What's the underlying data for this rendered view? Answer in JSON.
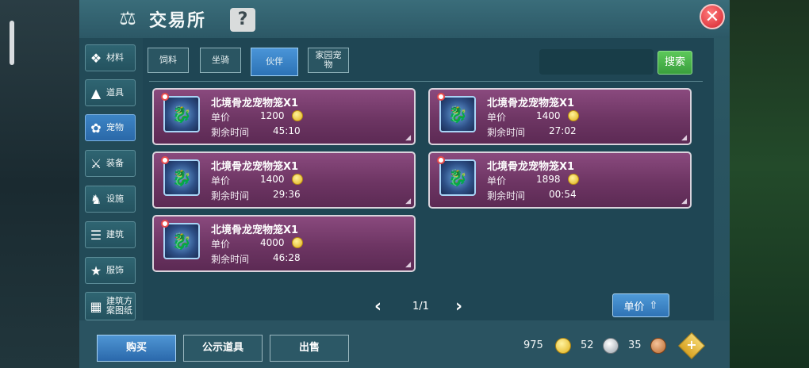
{
  "window": {
    "title": "交易所",
    "help_label": "?",
    "close_label": "✕"
  },
  "sidebar": {
    "items": [
      {
        "label": "材料",
        "icon": "materials-icon"
      },
      {
        "label": "道具",
        "icon": "item-flask-icon"
      },
      {
        "label": "宠物",
        "icon": "paw-icon",
        "active": true
      },
      {
        "label": "装备",
        "icon": "equipment-icon"
      },
      {
        "label": "设施",
        "icon": "facility-icon"
      },
      {
        "label": "建筑",
        "icon": "building-icon"
      },
      {
        "label": "服饰",
        "icon": "clothing-icon"
      },
      {
        "label": "建筑方案图纸",
        "icon": "blueprint-icon"
      }
    ]
  },
  "tabs": [
    {
      "label": "饲料"
    },
    {
      "label": "坐骑"
    },
    {
      "label": "伙伴",
      "active": true
    },
    {
      "label": "家园宠物"
    }
  ],
  "search": {
    "placeholder": "",
    "button_label": "搜索"
  },
  "listing_labels": {
    "price": "单价",
    "time": "剩余时间"
  },
  "listings": [
    {
      "name": "北境骨龙宠物笼X1",
      "price": "1200",
      "time": "45:10"
    },
    {
      "name": "北境骨龙宠物笼X1",
      "price": "1400",
      "time": "27:02"
    },
    {
      "name": "北境骨龙宠物笼X1",
      "price": "1400",
      "time": "29:36"
    },
    {
      "name": "北境骨龙宠物笼X1",
      "price": "1898",
      "time": "00:54"
    },
    {
      "name": "北境骨龙宠物笼X1",
      "price": "4000",
      "time": "46:28"
    }
  ],
  "pager": {
    "text": "1/1"
  },
  "sort": {
    "label": "单价"
  },
  "bottom": {
    "buy_label": "购买",
    "public_label": "公示道具",
    "sell_label": "出售",
    "gold": "975",
    "silver": "52",
    "bronze": "35"
  },
  "colors": {
    "accent": "#2f73b5",
    "card": "#6d3563",
    "search_green": "#3a9f3d"
  }
}
